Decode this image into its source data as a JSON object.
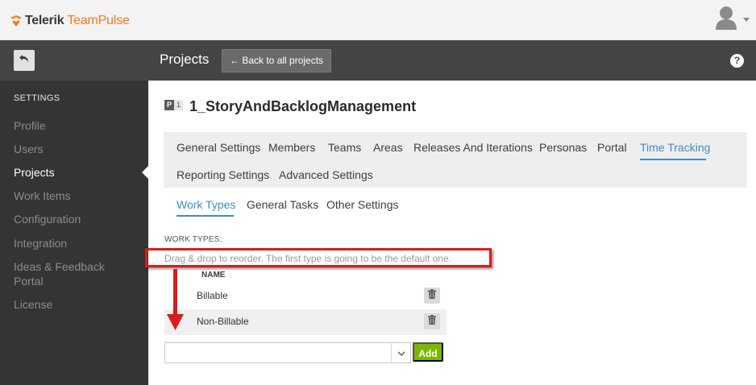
{
  "header": {
    "brand_a": "Telerik",
    "brand_b": "TeamPulse",
    "brand_color": "#f47a1f",
    "user_icon": "user-avatar-icon"
  },
  "topbar": {
    "page_title": "Projects",
    "back_button_label": "← Back to all projects",
    "help_label": "?"
  },
  "sidebar": {
    "heading": "SETTINGS",
    "items": [
      {
        "label": "Profile"
      },
      {
        "label": "Users"
      },
      {
        "label": "Projects",
        "active": true
      },
      {
        "label": "Work Items"
      },
      {
        "label": "Configuration"
      },
      {
        "label": "Integration"
      },
      {
        "label": "Ideas & Feedback\nPortal"
      },
      {
        "label": "License"
      }
    ]
  },
  "project": {
    "badge_letter": "P",
    "badge_number": "1",
    "name": "1_StoryAndBacklogManagement"
  },
  "tabs": [
    {
      "label": "General Settings"
    },
    {
      "label": "Members"
    },
    {
      "label": "Teams"
    },
    {
      "label": "Areas"
    },
    {
      "label": "Releases And Iterations"
    },
    {
      "label": "Personas"
    },
    {
      "label": "Portal"
    },
    {
      "label": "Time Tracking",
      "active": true
    },
    {
      "label": "Reporting Settings"
    },
    {
      "label": "Advanced Settings"
    }
  ],
  "subtabs": [
    {
      "label": "Work Types",
      "active": true
    },
    {
      "label": "General Tasks"
    },
    {
      "label": "Other Settings"
    }
  ],
  "work_types": {
    "section_label": "WORK TYPES:",
    "hint": "Drag & drop to reorder. The first type is going to be the default one.",
    "column_name": "NAME",
    "rows": [
      {
        "name": "Billable"
      },
      {
        "name": "Non-Billable"
      }
    ],
    "select_value": "",
    "add_label": "Add"
  },
  "colors": {
    "accent": "#3f8ccc",
    "highlight_red": "#d81c1c",
    "add_green": "#7ab800",
    "sidebar_bg": "#343434",
    "band_bg": "#444444"
  }
}
